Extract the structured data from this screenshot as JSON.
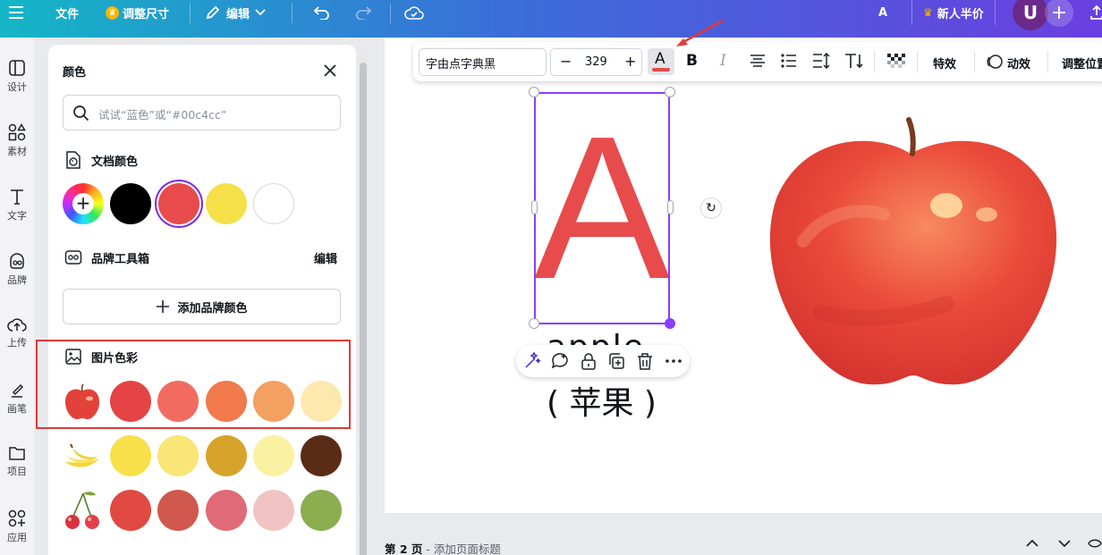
{
  "topbar": {
    "file_label": "文件",
    "resize_label": "调整尺寸",
    "edit_label": "编辑",
    "half_price_label": "新人半价",
    "avatar_letter": "U",
    "font_a": "A"
  },
  "rail": {
    "items": [
      {
        "label": "设计"
      },
      {
        "label": "素材"
      },
      {
        "label": "文字"
      },
      {
        "label": "品牌"
      },
      {
        "label": "上传"
      },
      {
        "label": "画笔"
      },
      {
        "label": "项目"
      },
      {
        "label": "应用"
      }
    ]
  },
  "panel": {
    "title": "颜色",
    "search_placeholder": "试试“蓝色”或“#00c4cc”",
    "doc_colors_title": "文档颜色",
    "doc_colors": [
      "#000000",
      "#e84b4b",
      "#f5e04a",
      "#ffffff"
    ],
    "brand_kit_title": "品牌工具箱",
    "brand_kit_edit": "编辑",
    "add_brand_color": "添加品牌颜色",
    "image_colors_title": "图片色彩",
    "image_palettes": [
      {
        "subject": "apple",
        "colors": [
          "#e54444",
          "#f26b60",
          "#f07a4c",
          "#f4a061",
          "#fde8ae"
        ]
      },
      {
        "subject": "banana",
        "colors": [
          "#f7e04a",
          "#f8e676",
          "#d6a42a",
          "#faf1a3",
          "#5a2c17"
        ]
      },
      {
        "subject": "cherry",
        "colors": [
          "#e14a43",
          "#d0584c",
          "#e06a77",
          "#f1c4c3",
          "#8cae4f"
        ]
      }
    ]
  },
  "toolbar": {
    "font_name": "字由点字典黑",
    "font_size": "329",
    "minus": "−",
    "plus": "+",
    "text_color_letter": "A",
    "effects": "特效",
    "animate": "动效",
    "position": "调整位置"
  },
  "canvas": {
    "big_letter": "A",
    "word": "apple",
    "word_cn": "( 苹果 )"
  },
  "bottom": {
    "page": "第 2 页",
    "page_title_hint": "- 添加页面标题"
  }
}
